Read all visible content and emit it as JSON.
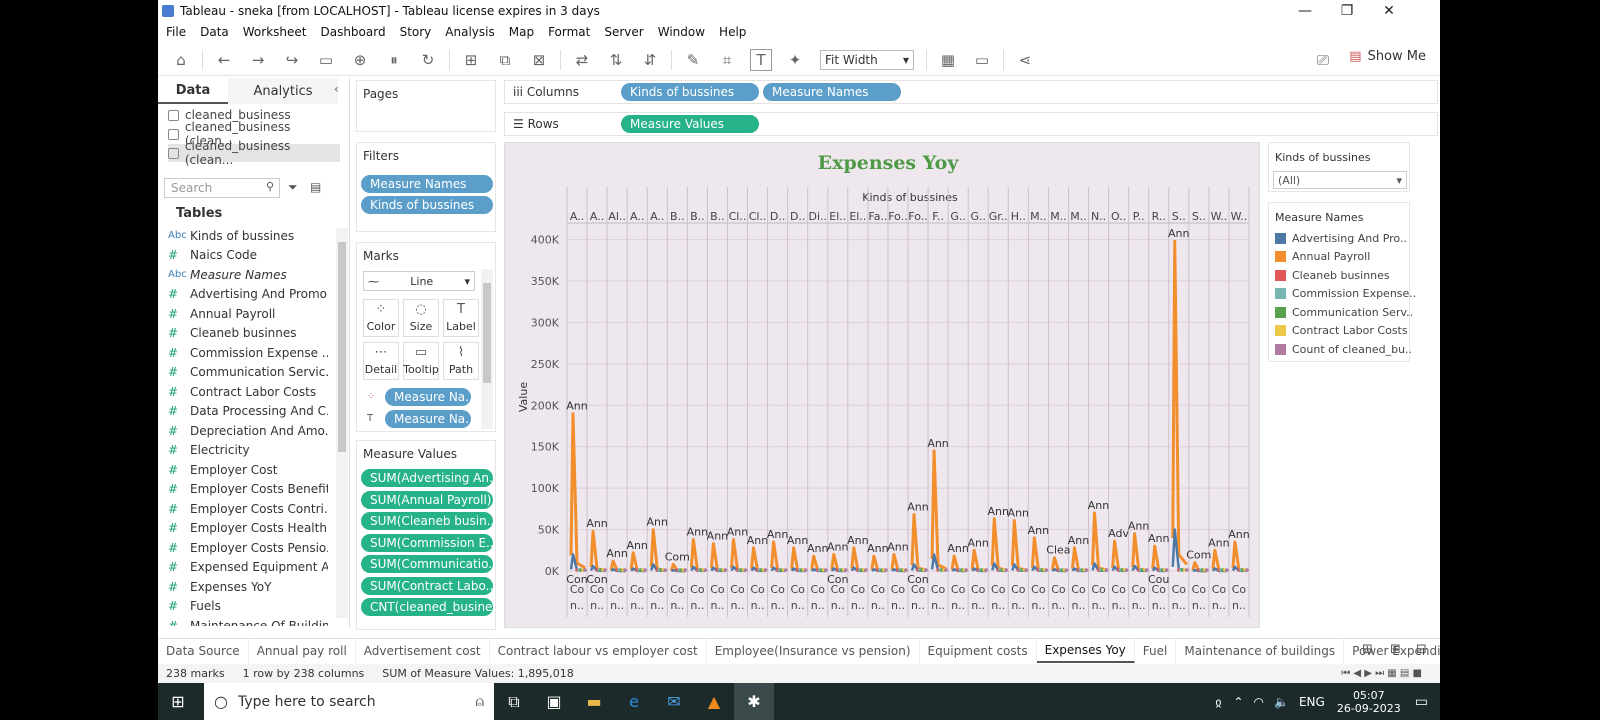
{
  "window": {
    "title": "Tableau - sneka [from LOCALHOST] - Tableau license expires in 3 days",
    "minimize": "—",
    "maximize": "❐",
    "close": "✕"
  },
  "menu": [
    "File",
    "Data",
    "Worksheet",
    "Dashboard",
    "Story",
    "Analysis",
    "Map",
    "Format",
    "Server",
    "Window",
    "Help"
  ],
  "toolbar": {
    "fit": "Fit Width",
    "show_me": "Show Me"
  },
  "left": {
    "tab_data": "Data",
    "tab_analytics": "Analytics",
    "datasources": [
      "cleaned_business",
      "cleaned_business (clean...",
      "cleaned_business (clean..."
    ],
    "search_placeholder": "Search",
    "tables_heading": "Tables",
    "fields": [
      {
        "type": "Abc",
        "name": "Kinds of bussines"
      },
      {
        "type": "#",
        "name": "Naics Code"
      },
      {
        "type": "Abc",
        "name": "Measure Names"
      },
      {
        "type": "#",
        "name": "Advertising And Promo..."
      },
      {
        "type": "#",
        "name": "Annual Payroll"
      },
      {
        "type": "#",
        "name": "Cleaneb businnes"
      },
      {
        "type": "#",
        "name": "Commission Expense ..."
      },
      {
        "type": "#",
        "name": "Communication Servic..."
      },
      {
        "type": "#",
        "name": "Contract Labor Costs"
      },
      {
        "type": "#",
        "name": "Data Processing And C..."
      },
      {
        "type": "#",
        "name": "Depreciation And Amo..."
      },
      {
        "type": "#",
        "name": "Electricity"
      },
      {
        "type": "#",
        "name": "Employer Cost"
      },
      {
        "type": "#",
        "name": "Employer Costs Benefits"
      },
      {
        "type": "#",
        "name": "Employer Costs Contri..."
      },
      {
        "type": "#",
        "name": "Employer Costs Health..."
      },
      {
        "type": "#",
        "name": "Employer Costs Pensio..."
      },
      {
        "type": "#",
        "name": "Expensed Equipment A..."
      },
      {
        "type": "#",
        "name": "Expenses YoY"
      },
      {
        "type": "#",
        "name": "Fuels"
      },
      {
        "type": "#",
        "name": "Maintenance Of Buildin..."
      }
    ]
  },
  "pages_label": "Pages",
  "filters": {
    "label": "Filters",
    "pills": [
      "Measure Names",
      "Kinds of bussines"
    ]
  },
  "marks": {
    "label": "Marks",
    "type": "Line",
    "buttons": [
      "Color",
      "Size",
      "Label",
      "Detail",
      "Tooltip",
      "Path"
    ],
    "pills": [
      "Measure Na..",
      "Measure Na.."
    ]
  },
  "measure_values": {
    "label": "Measure Values",
    "pills": [
      "SUM(Advertising An..",
      "SUM(Annual Payroll)",
      "SUM(Cleaneb busin..",
      "SUM(Commission E..",
      "SUM(Communicatio..",
      "SUM(Contract Labo..",
      "CNT(cleaned_busine.."
    ]
  },
  "shelves": {
    "columns_label": "Columns",
    "columns_pills": [
      "Kinds of bussines",
      "Measure Names"
    ],
    "rows_label": "Rows",
    "rows_pills": [
      "Measure Values"
    ]
  },
  "legend_kinds": {
    "title": "Kinds of bussines",
    "value": "(All)"
  },
  "legend_measures": {
    "title": "Measure Names",
    "items": [
      {
        "name": "Advertising And Pro..",
        "color": "#4e79a7"
      },
      {
        "name": "Annual Payroll",
        "color": "#f28e2b"
      },
      {
        "name": "Cleaneb businnes",
        "color": "#e15759"
      },
      {
        "name": "Commission Expense..",
        "color": "#76b7b2"
      },
      {
        "name": "Communication Serv..",
        "color": "#59a14f"
      },
      {
        "name": "Contract Labor Costs",
        "color": "#edc948"
      },
      {
        "name": "Count of cleaned_bu..",
        "color": "#b07aa1"
      }
    ]
  },
  "chart_data": {
    "type": "line",
    "title": "Expenses Yoy",
    "xlabel": "Kinds of bussines",
    "ylabel": "Value",
    "ylim": [
      0,
      420000
    ],
    "yticks": [
      "0K",
      "50K",
      "100K",
      "150K",
      "200K",
      "250K",
      "300K",
      "350K",
      "400K"
    ],
    "grid": true,
    "categories": [
      "A..",
      "A..",
      "Al..",
      "A..",
      "A..",
      "B..",
      "B..",
      "B..",
      "Cl..",
      "Cl..",
      "D..",
      "D..",
      "Di..",
      "El..",
      "El..",
      "Fa..",
      "Fo..",
      "Fo..",
      "F..",
      "G..",
      "G..",
      "Gr..",
      "H..",
      "M..",
      "M..",
      "M..",
      "N..",
      "O..",
      "P..",
      "R..",
      "S..",
      "S..",
      "W..",
      "W.."
    ],
    "series": [
      {
        "name": "Annual Payroll",
        "values": [
          190000,
          48000,
          12000,
          22000,
          50000,
          8000,
          38000,
          33000,
          38000,
          28000,
          35000,
          28000,
          18000,
          20000,
          28000,
          18000,
          20000,
          68000,
          145000,
          18000,
          25000,
          63000,
          61000,
          40000,
          16000,
          28000,
          70000,
          36000,
          45000,
          30000,
          398000,
          10000,
          25000,
          35000
        ]
      },
      {
        "name": "Advertising And Pro..",
        "values": [
          20000,
          6000,
          2000,
          3000,
          8000,
          1000,
          5000,
          4000,
          5000,
          4000,
          4000,
          3000,
          2000,
          3000,
          4000,
          2000,
          2000,
          8000,
          20000,
          2000,
          3000,
          9000,
          8000,
          5000,
          2000,
          3000,
          9000,
          5000,
          6000,
          4000,
          50000,
          1000,
          3000,
          5000
        ]
      }
    ],
    "data_labels": {
      "top": [
        "Ann",
        "Ann",
        "Ann",
        "Ann",
        "Ann",
        "Com",
        "Ann",
        "Ann",
        "Ann",
        "Ann",
        "Ann",
        "Ann",
        "Ann",
        "Ann",
        "Ann",
        "Ann",
        "Ann",
        "Ann",
        "Ann",
        "Ann",
        "Ann",
        "Ann",
        "Ann",
        "Ann",
        "Clea",
        "Ann",
        "Ann",
        "Adv",
        "Ann",
        "Ann",
        "Ann",
        "Com",
        "Ann",
        "Ann"
      ],
      "bottom": [
        "Con",
        "Con",
        "Con",
        "Con",
        "Cou"
      ]
    },
    "x_bottom_labels": [
      "Co n..",
      "Co n..",
      "Co n..",
      "Co n..",
      "Co n..",
      "Co n..",
      "Co n..",
      "Co n..",
      "Co n..",
      "Co n..",
      "Co n..",
      "Co n..",
      "Co n..",
      "Co n..",
      "Co n..",
      "Co n..",
      "Co n..",
      "Co n..",
      "Co n..",
      "Co n..",
      "Co n..",
      "Co n..",
      "Co n..",
      "Co n..",
      "Co n..",
      "Co n..",
      "Co n..",
      "Co n..",
      "Co n..",
      "Co n..",
      "Co n..",
      "Co n..",
      "Co n..",
      "Co n.."
    ]
  },
  "sheet_tabs": [
    "Data Source",
    "Annual pay roll",
    "Advertisement cost",
    "Contract labour vs employer cost",
    "Employee(Insurance vs pension)",
    "Equipment costs",
    "Expenses Yoy",
    "Fuel",
    "Maintenance of buildings",
    "Power Expenditure"
  ],
  "active_tab": "Expenses Yoy",
  "status": {
    "marks": "238 marks",
    "rows": "1 row by 238 columns",
    "sum": "SUM of Measure Values: 1,895,018"
  },
  "taskbar": {
    "search_placeholder": "Type here to search",
    "lang": "ENG",
    "time": "05:07",
    "date": "26-09-2023"
  }
}
